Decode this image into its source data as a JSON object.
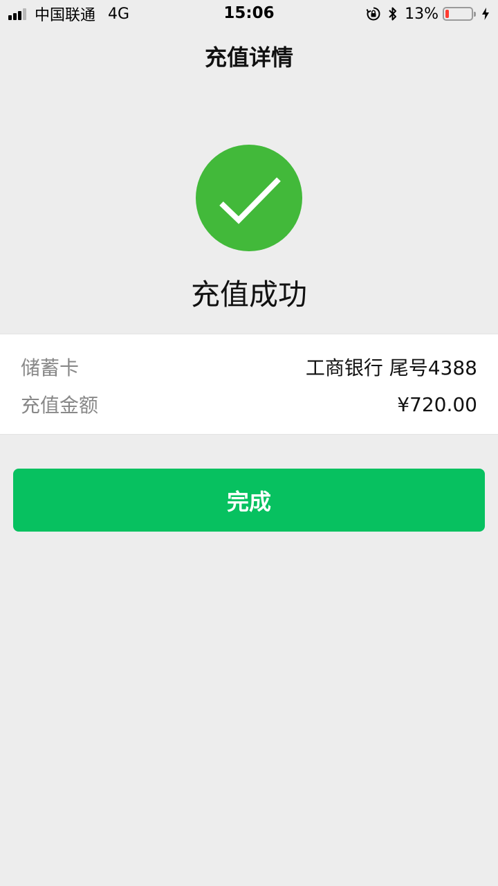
{
  "status_bar": {
    "carrier": "中国联通",
    "network": "4G",
    "time": "15:06",
    "battery_percent_label": "13%",
    "battery_level": 0.13,
    "battery_color": "#ff3b30",
    "icons": [
      "signal-icon",
      "rotation-lock-icon",
      "bluetooth-icon",
      "battery-icon",
      "charging-icon"
    ]
  },
  "header": {
    "title": "充值详情"
  },
  "result": {
    "icon": "checkmark-icon",
    "icon_color": "#42b93a",
    "title": "充值成功"
  },
  "details": [
    {
      "label": "储蓄卡",
      "value": "工商银行 尾号4388"
    },
    {
      "label": "充值金额",
      "value": "¥720.00"
    }
  ],
  "actions": {
    "done_label": "完成",
    "done_color": "#07c160"
  }
}
